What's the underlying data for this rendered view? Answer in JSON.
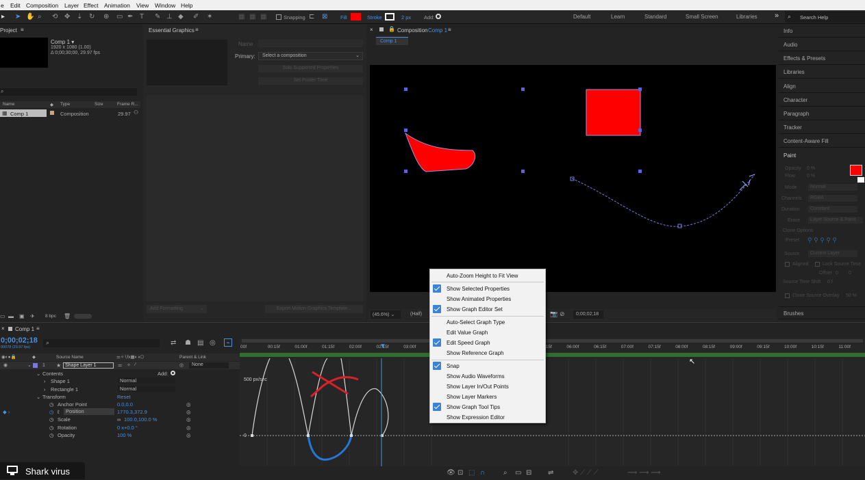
{
  "menubar": {
    "items": [
      "e",
      "Edit",
      "Composition",
      "Layer",
      "Effect",
      "Animation",
      "View",
      "Window",
      "Help"
    ]
  },
  "toolbar": {
    "snapping": "Snapping",
    "fill": "Fill",
    "stroke": "Stroke",
    "stroke_width": "2 px",
    "add": "Add:",
    "fill_color": "#ff0000",
    "workspaces": [
      "Default",
      "Learn",
      "Standard",
      "Small Screen",
      "Libraries"
    ],
    "search_placeholder": "Search Help"
  },
  "project": {
    "title": "Project",
    "comp_name": "Comp 1 ▾",
    "comp_size": "1920 x 1080 (1.00)",
    "comp_duration": "Δ 0;00;30;00, 29.97 fps",
    "columns": [
      "Name",
      "Type",
      "Size",
      "Frame R..."
    ],
    "row": {
      "name": "Comp 1",
      "type": "Composition",
      "fps": "29.97"
    },
    "bpc": "8 bpc"
  },
  "essential": {
    "title": "Essential Graphics",
    "name_label": "Name",
    "primary_label": "Primary:",
    "primary_value": "Select a composition",
    "solo_button": "Solo Supported Properties",
    "master_button": "Set Poster Time",
    "add_formatting": "Add Formatting",
    "export_button": "Export Motion Graphics Template..."
  },
  "composition": {
    "title": "Composition",
    "comp_link": "Comp 1",
    "tab": "Comp 1",
    "zoom": "(45.6%)",
    "resolution": "(Half)",
    "timecode": "0;00;02;18"
  },
  "context_menu": {
    "items": [
      {
        "label": "Auto-Zoom Height to Fit View",
        "checked": false
      },
      {
        "label": "Show Selected Properties",
        "checked": true
      },
      {
        "label": "Show Animated Properties",
        "checked": false
      },
      {
        "label": "Show Graph Editor Set",
        "checked": true
      },
      {
        "label": "Auto-Select Graph Type",
        "checked": false
      },
      {
        "label": "Edit Value Graph",
        "checked": false
      },
      {
        "label": "Edit Speed Graph",
        "checked": true
      },
      {
        "label": "Show Reference Graph",
        "checked": false
      },
      {
        "label": "Snap",
        "checked": true
      },
      {
        "label": "Show Audio Waveforms",
        "checked": false
      },
      {
        "label": "Show Layer In/Out Points",
        "checked": false
      },
      {
        "label": "Show Layer Markers",
        "checked": false
      },
      {
        "label": "Show Graph Tool Tips",
        "checked": true
      },
      {
        "label": "Show Expression Editor",
        "checked": false
      }
    ]
  },
  "right_panels": [
    "Info",
    "Audio",
    "Effects & Presets",
    "Libraries",
    "Align",
    "Character",
    "Paragraph",
    "Tracker",
    "Content-Aware Fill",
    "Paint"
  ],
  "paint": {
    "opacity": "Opacity",
    "opacity_val": "0 %",
    "flow": "Flow",
    "flow_val": "0 %",
    "mode": "Mode",
    "mode_val": "Normal",
    "channels": "Channels",
    "channels_val": "RGBA",
    "duration": "Duration",
    "duration_val": "Constant",
    "erase": "Erase",
    "erase_val": "Layer Source & Paint",
    "clone_options": "Clone Options",
    "preset": "Preset",
    "source": "Source",
    "source_val": "Current Layer",
    "aligned": "Aligned",
    "lock_source": "Lock Source Time",
    "offset": "Offset",
    "offset_x": "0",
    "offset_y": "0",
    "source_time_shift": "Source Time Shift",
    "source_time_val": "0 f",
    "clone_overlay": "Clone Source Overlay",
    "clone_overlay_val": "50 %",
    "brushes": "Brushes",
    "fg_color": "#ff0000"
  },
  "timeline": {
    "tab": "Comp 1",
    "timecode": "0;00;02;18",
    "fps_sub": "00078 (29.97 fps)",
    "col_source": "Source Name",
    "col_parent": "Parent & Link",
    "layer_num": "1",
    "layer_name": "Shape Layer 1",
    "parent": "None",
    "contents": "Contents",
    "add": "Add:",
    "shape1": "Shape 1",
    "rect1": "Rectangle 1",
    "normal": "Normal",
    "transform": "Transform",
    "reset": "Reset",
    "anchor": "Anchor Point",
    "anchor_val": "0.0,0.0",
    "position": "Position",
    "position_val": "1770.3,372.9",
    "scale": "Scale",
    "scale_val": "100.0,100.0 %",
    "rotation": "Rotation",
    "rotation_val": "0 x+0.0 °",
    "opacity": "Opacity",
    "opacity_val": "100 %",
    "ruler": [
      "00f",
      "00:15f",
      "01:00f",
      "01:15f",
      "02:00f",
      "02:15f",
      "03:00f",
      "03:15f",
      "04:00f",
      "04:15f",
      "05:00f",
      "05:15f",
      "06:00f",
      "06:15f",
      "07:00f",
      "07:15f",
      "08:00f",
      "08:15f",
      "09:00f",
      "09:15f",
      "10:00f",
      "10:15f",
      "11:00f"
    ],
    "graph_top": "500 px/sec",
    "graph_zero": "0"
  },
  "overlay": {
    "label": "Shark virus"
  }
}
